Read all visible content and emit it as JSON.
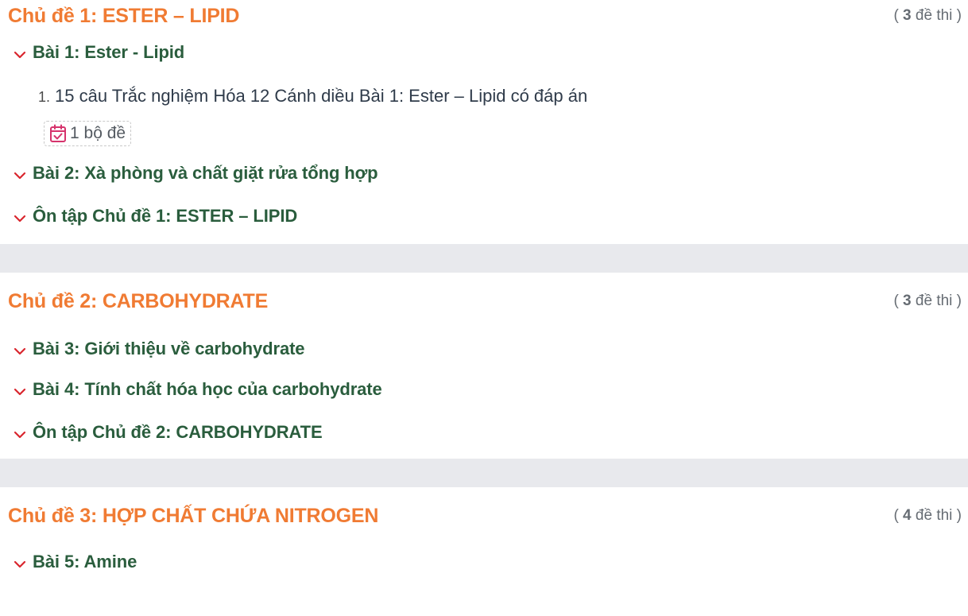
{
  "topics": [
    {
      "title": "Chủ đề 1: ESTER – LIPID",
      "count_open": "(",
      "count_num": "3",
      "count_label": "đề thi )",
      "lessons": [
        {
          "title": "Bài 1: Ester - Lipid",
          "expanded": true,
          "exams": [
            {
              "index": "1.",
              "title": "15 câu Trắc nghiệm Hóa 12 Cánh diều Bài 1: Ester – Lipid có đáp án"
            }
          ],
          "badge": "1 bộ đề"
        },
        {
          "title": "Bài 2: Xà phòng và chất giặt rửa tổng hợp"
        },
        {
          "title": "Ôn tập Chủ đề 1: ESTER – LIPID"
        }
      ]
    },
    {
      "title": "Chủ đề 2: CARBOHYDRATE",
      "count_open": "(",
      "count_num": "3",
      "count_label": "đề thi )",
      "lessons": [
        {
          "title": "Bài 3: Giới thiệu về carbohydrate"
        },
        {
          "title": "Bài 4: Tính chất hóa học của carbohydrate"
        },
        {
          "title": "Ôn tập Chủ đề 2: CARBOHYDRATE"
        }
      ]
    },
    {
      "title": "Chủ đề 3: HỢP CHẤT CHỨA NITROGEN",
      "count_open": "(",
      "count_num": "4",
      "count_label": "đề thi )",
      "lessons": [
        {
          "title": "Bài 5: Amine"
        }
      ]
    }
  ],
  "colors": {
    "topic_title": "#f07b33",
    "lesson_title": "#2a5d3d",
    "chevron": "#d9262e",
    "badge_icon": "#d6336c",
    "separator": "#e8e9ed"
  },
  "icons": {
    "lesson_toggle": "chevron-down-icon",
    "badge": "calendar-check-icon"
  }
}
